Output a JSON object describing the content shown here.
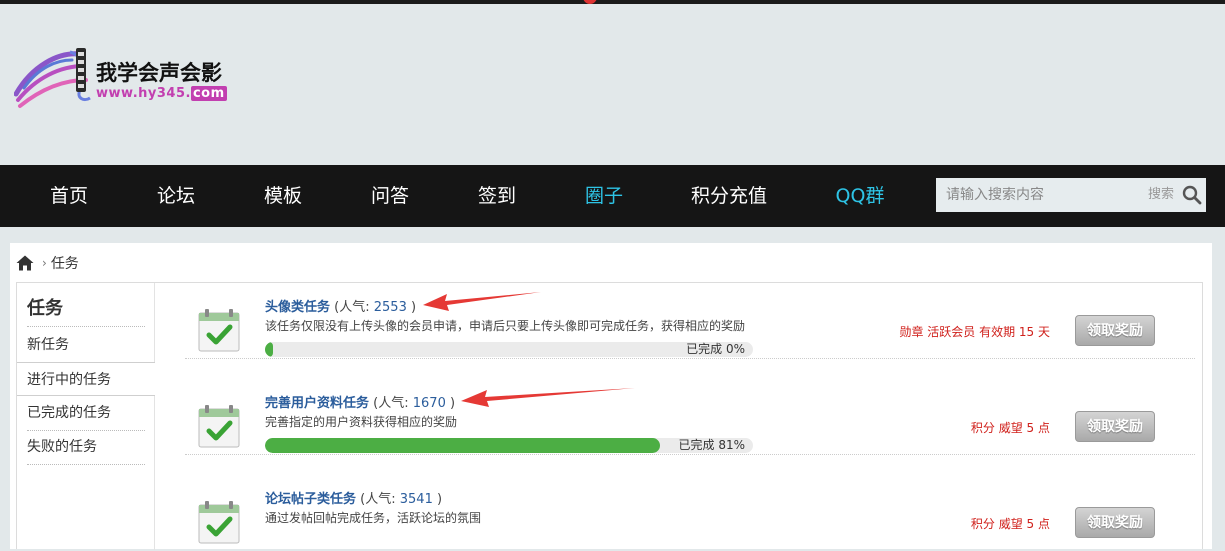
{
  "logo": {
    "site_name": "我学会声会影",
    "url_main": "www.hy345.",
    "url_tld": "com"
  },
  "nav": {
    "items": [
      {
        "label": "首页",
        "highlight": false
      },
      {
        "label": "论坛",
        "highlight": false
      },
      {
        "label": "模板",
        "highlight": false
      },
      {
        "label": "问答",
        "highlight": false
      },
      {
        "label": "签到",
        "highlight": false
      },
      {
        "label": "圈子",
        "highlight": true
      },
      {
        "label": "积分充值",
        "highlight": false
      },
      {
        "label": "QQ群",
        "highlight": true
      }
    ],
    "search_placeholder": "请输入搜索内容",
    "search_label": "搜索"
  },
  "breadcrumb": {
    "current": "任务"
  },
  "sidebar": {
    "title": "任务",
    "items": [
      {
        "label": "新任务",
        "active": false
      },
      {
        "label": "进行中的任务",
        "active": true
      },
      {
        "label": "已完成的任务",
        "active": false
      },
      {
        "label": "失败的任务",
        "active": false
      }
    ]
  },
  "tasks": [
    {
      "name": "头像类任务",
      "popularity_prefix": "(人气: ",
      "popularity": "2553",
      "popularity_suffix": ")",
      "description": "该任务仅限没有上传头像的会员申请，申请后只要上传头像即可完成任务，获得相应的奖励",
      "progress_percent": 0,
      "progress_text": "已完成 0%",
      "reward": "勋章 活跃会员 有效期 15 天",
      "button": "领取奖励"
    },
    {
      "name": "完善用户资料任务",
      "popularity_prefix": "(人气: ",
      "popularity": "1670",
      "popularity_suffix": ")",
      "description": "完善指定的用户资料获得相应的奖励",
      "progress_percent": 81,
      "progress_text": "已完成 81%",
      "reward": "积分 威望 5 点",
      "button": "领取奖励"
    },
    {
      "name": "论坛帖子类任务",
      "popularity_prefix": "(人气: ",
      "popularity": "3541",
      "popularity_suffix": ")",
      "description": "通过发帖回帖完成任务，活跃论坛的氛围",
      "progress_percent": null,
      "progress_text": "",
      "reward": "积分 威望 5 点",
      "button": "领取奖励"
    }
  ],
  "colors": {
    "nav_bg": "#151515",
    "nav_highlight": "#2ec4e6",
    "task_link": "#2b5d9c",
    "reward_red": "#d0211c",
    "progress_green": "#4cae44",
    "annotation_arrow": "#e53935"
  }
}
